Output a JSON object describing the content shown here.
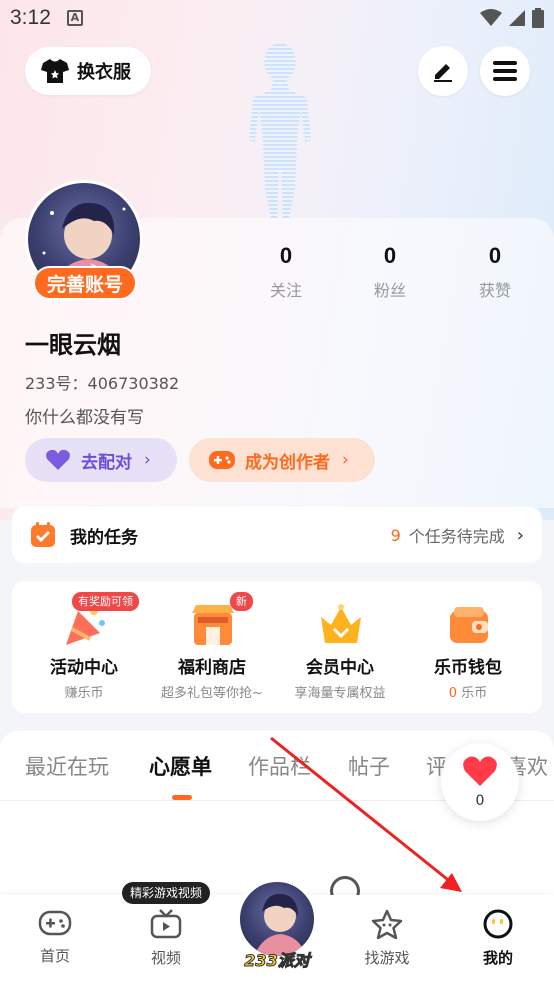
{
  "status_bar": {
    "time": "3:12",
    "notif_icon": "A"
  },
  "header": {
    "dress_label": "换衣服"
  },
  "profile": {
    "complete_label": "完善账号",
    "stats": [
      {
        "value": "0",
        "label": "关注"
      },
      {
        "value": "0",
        "label": "粉丝"
      },
      {
        "value": "0",
        "label": "获赞"
      }
    ],
    "username": "一眼云烟",
    "uid": "233号：406730382",
    "bio": "你什么都没有写",
    "match_label": "去配对",
    "creator_label": "成为创作者"
  },
  "tasks": {
    "title": "我的任务",
    "count": "9",
    "suffix": "个任务待完成"
  },
  "services": [
    {
      "name": "活动中心",
      "sub": "赚乐币",
      "badge": "有奖励可领"
    },
    {
      "name": "福利商店",
      "sub": "超多礼包等你抢~",
      "badge": "新"
    },
    {
      "name": "会员中心",
      "sub": "享海量专属权益"
    },
    {
      "name": "乐币钱包",
      "sub_value": "0",
      "sub": "乐币"
    }
  ],
  "tabs": [
    "最近在玩",
    "心愿单",
    "作品栏",
    "帖子",
    "评",
    "喜欢"
  ],
  "like_bubble": {
    "count": "0"
  },
  "bottom_nav": {
    "video_tip": "精彩游戏视频",
    "items": [
      {
        "label": "首页",
        "icon": "gamepad-icon"
      },
      {
        "label": "视频",
        "icon": "tv-icon"
      },
      {
        "label": "233派对",
        "icon": "party-avatar"
      },
      {
        "label": "找游戏",
        "icon": "star-icon"
      },
      {
        "label": "我的",
        "icon": "smile-icon"
      }
    ]
  },
  "colors": {
    "accent": "#ff6a1f",
    "purple": "#6a4fd6",
    "red": "#f04848"
  }
}
